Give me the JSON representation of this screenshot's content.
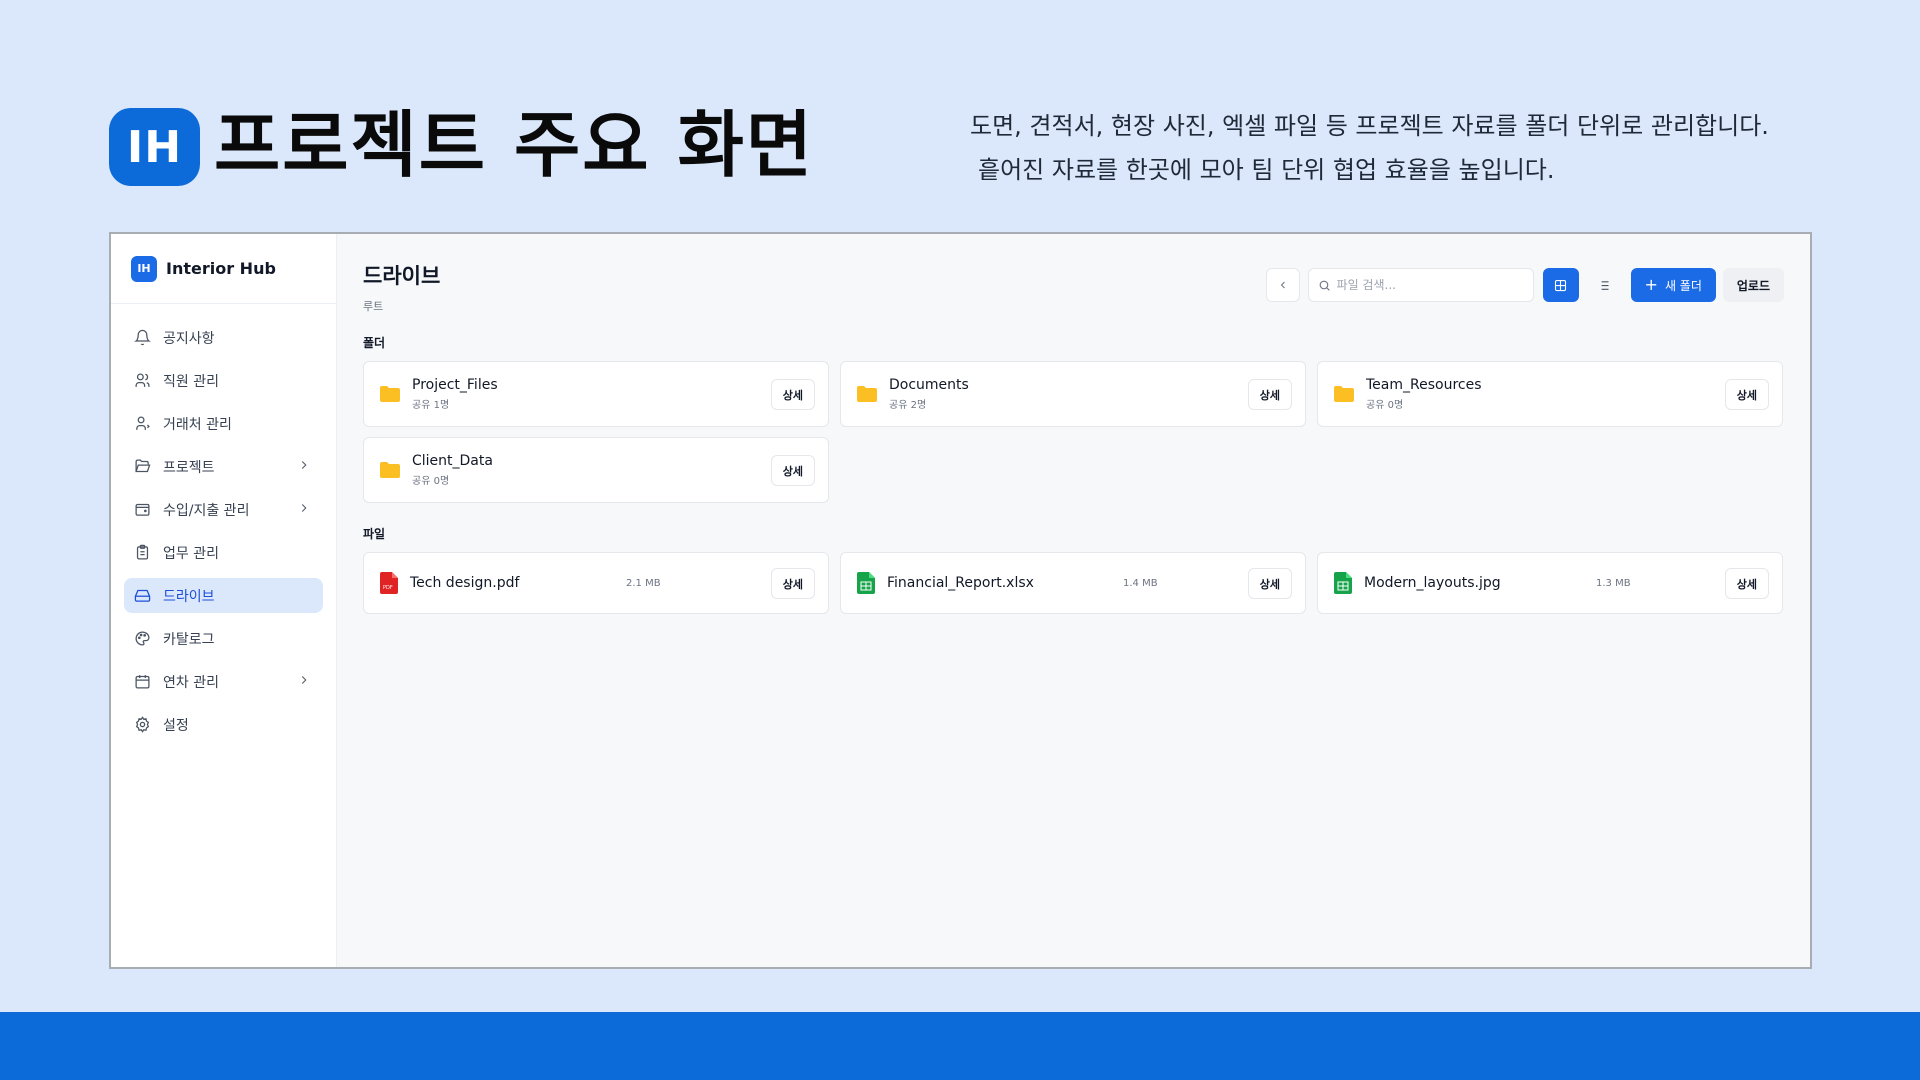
{
  "slide": {
    "logo_text": "IH",
    "title": "프로젝트 주요 화면",
    "description_line1": "도면, 견적서, 현장 사진, 엑셀 파일 등 프로젝트 자료를 폴더 단위로 관리합니다.",
    "description_line2": "흩어진 자료를 한곳에 모아 팀 단위 협업 효율을 높입니다.",
    "accent_color": "#0d6ad9"
  },
  "app": {
    "brand": {
      "logo_text": "IH",
      "name": "Interior Hub"
    },
    "sidebar": {
      "items": [
        {
          "label": "공지사항",
          "icon": "bell-icon",
          "active": false,
          "has_chevron": false
        },
        {
          "label": "직원 관리",
          "icon": "users-icon",
          "active": false,
          "has_chevron": false
        },
        {
          "label": "거래처 관리",
          "icon": "user-group-icon",
          "active": false,
          "has_chevron": false
        },
        {
          "label": "프로젝트",
          "icon": "folder-open-icon",
          "active": false,
          "has_chevron": true
        },
        {
          "label": "수입/지출 관리",
          "icon": "wallet-icon",
          "active": false,
          "has_chevron": true
        },
        {
          "label": "업무 관리",
          "icon": "clipboard-icon",
          "active": false,
          "has_chevron": false
        },
        {
          "label": "드라이브",
          "icon": "drive-icon",
          "active": true,
          "has_chevron": false
        },
        {
          "label": "카탈로그",
          "icon": "palette-icon",
          "active": false,
          "has_chevron": false
        },
        {
          "label": "연차 관리",
          "icon": "calendar-icon",
          "active": false,
          "has_chevron": true
        },
        {
          "label": "설정",
          "icon": "gear-icon",
          "active": false,
          "has_chevron": false
        }
      ]
    },
    "main": {
      "title": "드라이브",
      "breadcrumb": "루트",
      "search_placeholder": "파일 검색...",
      "new_folder_label": "새 폴더",
      "upload_label": "업로드",
      "folders_label": "폴더",
      "files_label": "파일",
      "detail_label": "상세",
      "folders": [
        {
          "name": "Project_Files",
          "shared": "공유 1명"
        },
        {
          "name": "Documents",
          "shared": "공유 2명"
        },
        {
          "name": "Team_Resources",
          "shared": "공유 0명"
        },
        {
          "name": "Client_Data",
          "shared": "공유 0명"
        }
      ],
      "files": [
        {
          "name": "Tech design.pdf",
          "size": "2.1 MB",
          "type": "pdf"
        },
        {
          "name": "Financial_Report.xlsx",
          "size": "1.4 MB",
          "type": "sheet"
        },
        {
          "name": "Modern_layouts.jpg",
          "size": "1.3 MB",
          "type": "sheet"
        }
      ],
      "colors": {
        "primary": "#1b6ae6",
        "folder": "#fbbf24",
        "pdf": "#e02424",
        "sheet": "#16a34a"
      }
    }
  }
}
